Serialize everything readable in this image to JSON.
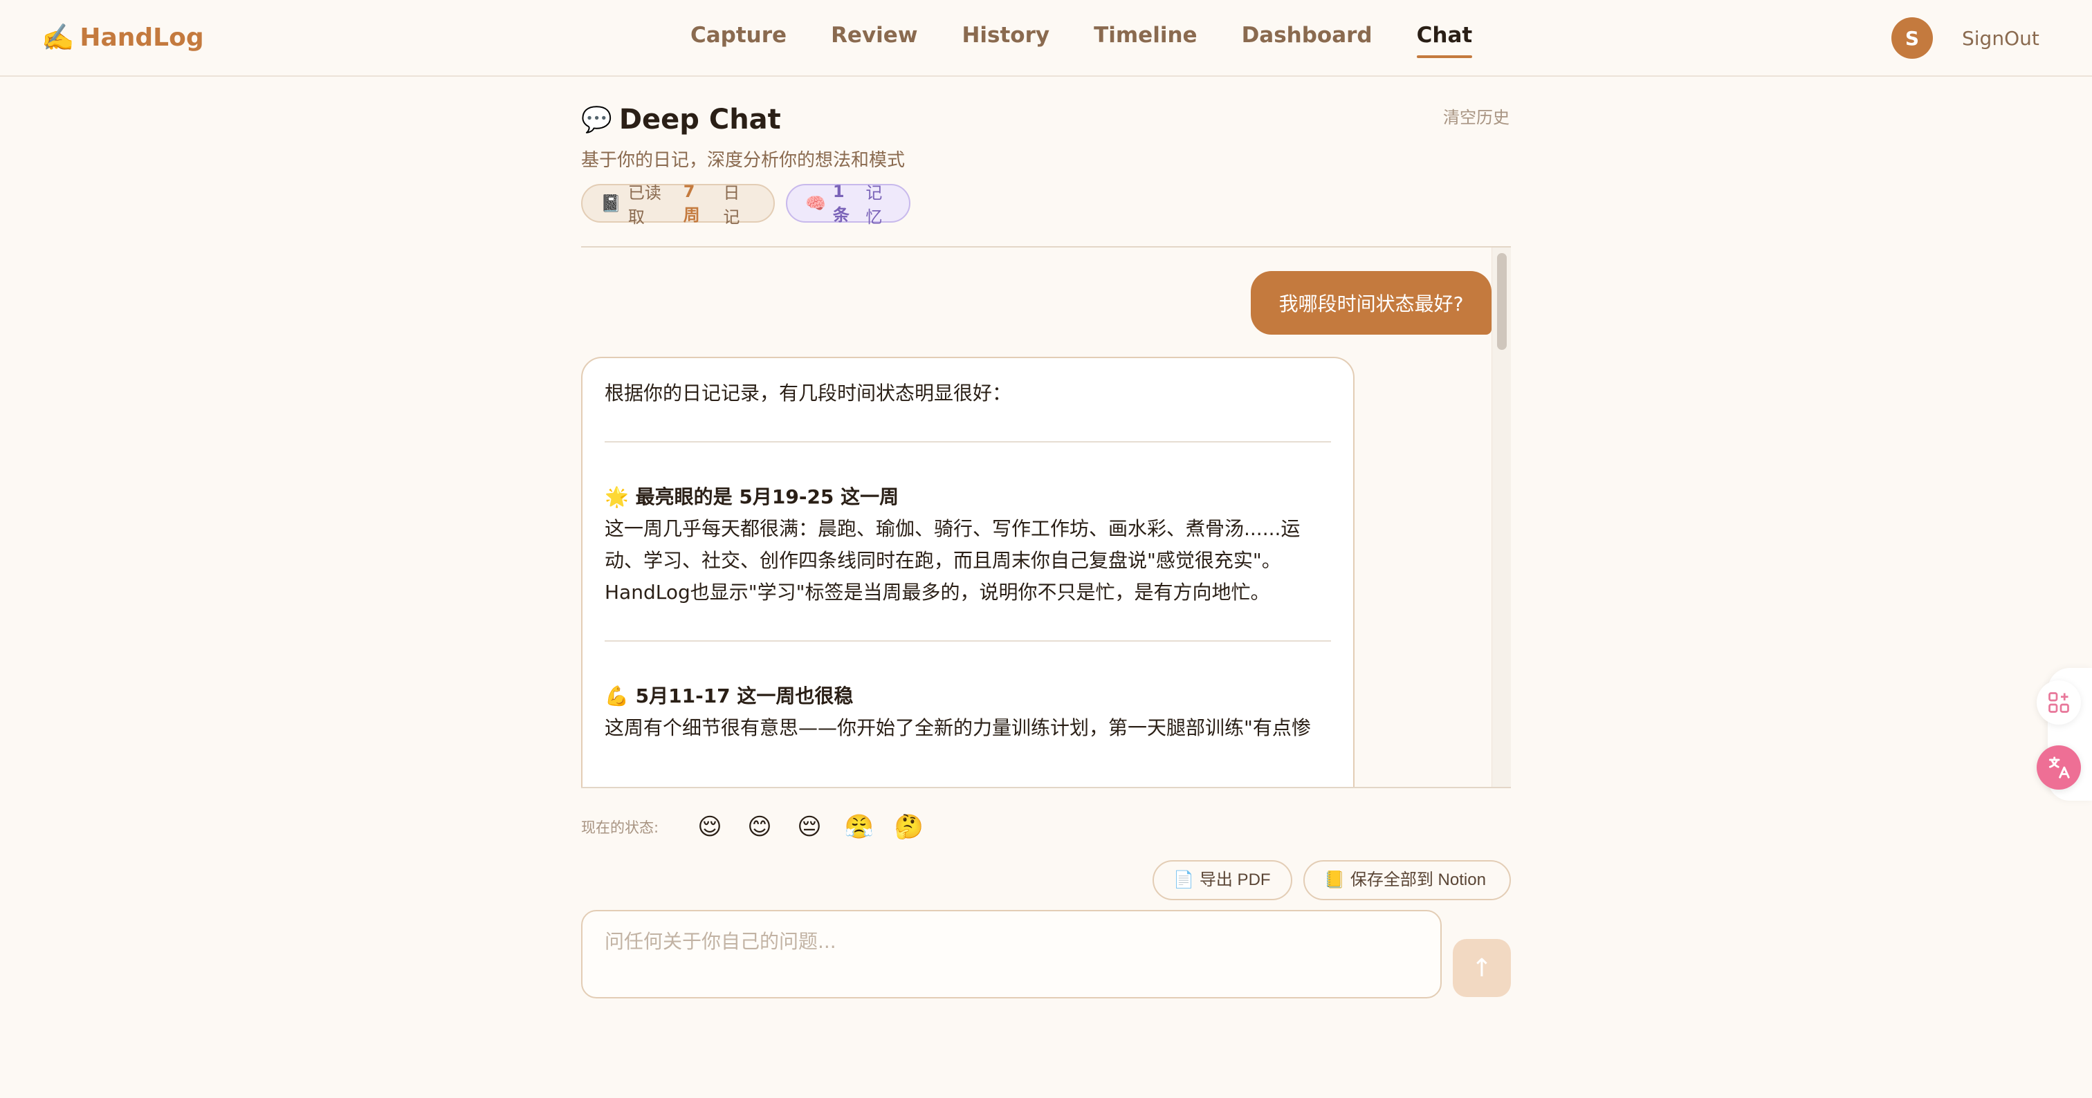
{
  "app": {
    "brand_icon": "✍️",
    "brand_name": "HandLog"
  },
  "nav": {
    "items": [
      {
        "label": "Capture"
      },
      {
        "label": "Review"
      },
      {
        "label": "History"
      },
      {
        "label": "Timeline"
      },
      {
        "label": "Dashboard"
      },
      {
        "label": "Chat",
        "active": true
      }
    ]
  },
  "user": {
    "avatar_initial": "S",
    "signout_label": "SignOut"
  },
  "header": {
    "title_icon": "💬",
    "title": "Deep Chat",
    "clear_history_label": "清空历史",
    "subtitle": "基于你的日记，深度分析你的想法和模式",
    "chip_read": {
      "icon": "📓",
      "prefix": "已读取",
      "count": "7 周",
      "suffix": "日记"
    },
    "chip_memory": {
      "icon": "🧠",
      "count": "1 条",
      "suffix": "记忆"
    }
  },
  "chat": {
    "user_message": "我哪段时间状态最好?",
    "ai_message": {
      "intro": "根据你的日记记录，有几段时间状态明显很好：",
      "section1_icon": "🌟",
      "section1_title": "最亮眼的是 5月19-25 这一周",
      "section1_line1": "这一周几乎每天都很满：晨跑、瑜伽、骑行、写作工作坊、画水彩、煮骨汤......运",
      "section1_line2": "动、学习、社交、创作四条线同时在跑，而且周末你自己复盘说\"感觉很充实\"。",
      "section1_line3": "HandLog也显示\"学习\"标签是当周最多的，说明你不只是忙，是有方向地忙。",
      "section2_icon": "💪",
      "section2_title": "5月11-17 这一周也很稳",
      "section2_line1": "这周有个细节很有意思——你开始了全新的力量训练计划，第一天腿部训练\"有点惨"
    }
  },
  "mood": {
    "label": "现在的状态:",
    "options": [
      "😌",
      "😊",
      "😔",
      "😤",
      "🤔"
    ]
  },
  "actions": {
    "export_pdf_icon": "📄",
    "export_pdf_label": "导出 PDF",
    "save_notion_icon": "📒",
    "save_notion_label": "保存全部到 Notion"
  },
  "composer": {
    "placeholder": "问任何关于你自己的问题...",
    "send_icon": "↑"
  },
  "colors": {
    "accent": "#c47a3e",
    "background": "#fdf9f4",
    "memory_chip": "#efe9fb",
    "translate_widget": "#ee6f95"
  },
  "icons": {
    "apps_widget": "apps-sparkle-icon",
    "translate_widget": "translate-icon"
  }
}
